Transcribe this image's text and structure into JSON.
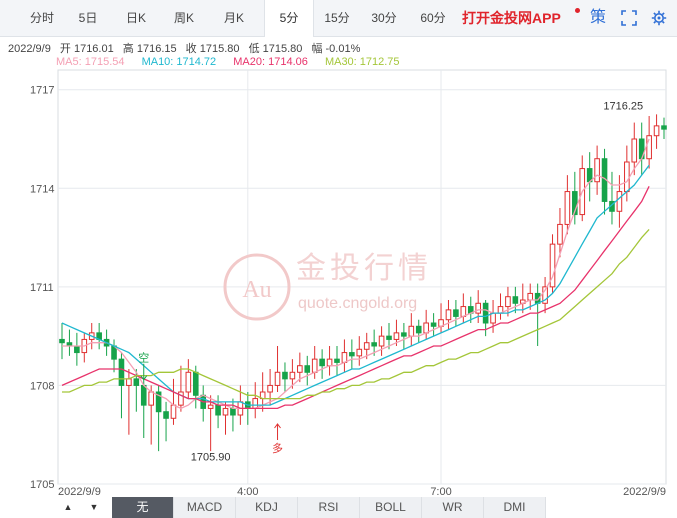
{
  "tabs": [
    "分时",
    "5日",
    "日K",
    "周K",
    "月K",
    "5分",
    "15分",
    "30分",
    "60分"
  ],
  "active_tab": 5,
  "promo": "打开金投网APP",
  "icons": {
    "strategy": "策",
    "fullscreen": "fullscreen-icon",
    "settings": "gear-icon"
  },
  "info": {
    "date": "2022/9/9",
    "open_label": "开",
    "open": "1716.01",
    "high_label": "高",
    "high": "1716.15",
    "close_label": "收",
    "close": "1715.80",
    "low_label": "低",
    "low": "1715.80",
    "change_label": "幅",
    "change": "-0.01%"
  },
  "ma_legend": [
    {
      "label": "MA5: 1715.54",
      "color": "#f4a0b4"
    },
    {
      "label": "MA10: 1714.72",
      "color": "#1fb8cf"
    },
    {
      "label": "MA20: 1714.06",
      "color": "#e8336b"
    },
    {
      "label": "MA30: 1712.75",
      "color": "#a4c639"
    }
  ],
  "watermark": {
    "cn": "金投行情",
    "en": "quote.cngold.org"
  },
  "bottom_tabs": [
    "无",
    "MACD",
    "KDJ",
    "RSI",
    "BOLL",
    "WR",
    "DMI"
  ],
  "bottom_active": 0,
  "chart_data": {
    "type": "candlestick",
    "y_ticks": [
      1717,
      1714,
      1711,
      1708,
      1705
    ],
    "ylim": [
      1705,
      1717.6
    ],
    "x_labels": [
      {
        "index": 0,
        "text": "2022/9/9"
      },
      {
        "index": 25,
        "text": "4:00"
      },
      {
        "index": 51,
        "text": "7:00"
      },
      {
        "index": 79,
        "text": "2022/9/9"
      }
    ],
    "colors": {
      "up": "#e03030",
      "down": "#16a34a"
    },
    "annotations": [
      {
        "text": "1716.25",
        "index": 79,
        "value": 1716.25
      },
      {
        "text": "1705.90",
        "index": 20,
        "value": 1705.9
      },
      {
        "text": "空",
        "index": 11,
        "value": 1708.6
      },
      {
        "text": "多",
        "index": 29,
        "value": 1706.4
      }
    ],
    "candles": [
      [
        1709.4,
        1709.3,
        1709.9,
        1708.8
      ],
      [
        1709.3,
        1709.2,
        1709.7,
        1708.9
      ],
      [
        1709.2,
        1709.0,
        1709.6,
        1708.6
      ],
      [
        1709.0,
        1709.4,
        1709.6,
        1708.7
      ],
      [
        1709.4,
        1709.6,
        1709.9,
        1709.1
      ],
      [
        1709.6,
        1709.4,
        1709.9,
        1709.1
      ],
      [
        1709.4,
        1709.2,
        1709.7,
        1708.9
      ],
      [
        1709.2,
        1708.8,
        1709.4,
        1708.4
      ],
      [
        1708.8,
        1708.0,
        1709.0,
        1707.0
      ],
      [
        1708.0,
        1708.2,
        1708.5,
        1706.5
      ],
      [
        1708.2,
        1708.0,
        1708.5,
        1707.2
      ],
      [
        1708.0,
        1707.4,
        1708.2,
        1706.4
      ],
      [
        1707.4,
        1707.8,
        1708.0,
        1706.2
      ],
      [
        1707.8,
        1707.2,
        1708.0,
        1706.0
      ],
      [
        1707.2,
        1707.0,
        1707.5,
        1706.3
      ],
      [
        1707.0,
        1707.4,
        1708.2,
        1706.8
      ],
      [
        1707.4,
        1707.8,
        1708.6,
        1707.2
      ],
      [
        1707.8,
        1708.4,
        1708.8,
        1707.6
      ],
      [
        1708.4,
        1707.7,
        1708.6,
        1707.3
      ],
      [
        1707.7,
        1707.3,
        1708.0,
        1706.9
      ],
      [
        1707.3,
        1707.4,
        1707.7,
        1706.0
      ],
      [
        1707.4,
        1707.1,
        1707.7,
        1706.7
      ],
      [
        1707.1,
        1707.3,
        1707.5,
        1706.5
      ],
      [
        1707.3,
        1707.1,
        1707.6,
        1706.6
      ],
      [
        1707.1,
        1707.5,
        1708.0,
        1706.8
      ],
      [
        1707.5,
        1707.3,
        1707.8,
        1706.8
      ],
      [
        1707.3,
        1707.6,
        1708.1,
        1707.0
      ],
      [
        1707.6,
        1707.8,
        1708.4,
        1707.2
      ],
      [
        1707.8,
        1708.0,
        1708.5,
        1707.4
      ],
      [
        1708.0,
        1708.4,
        1709.2,
        1707.8
      ],
      [
        1708.4,
        1708.2,
        1708.7,
        1707.8
      ],
      [
        1708.2,
        1708.4,
        1708.8,
        1707.9
      ],
      [
        1708.4,
        1708.6,
        1709.0,
        1708.1
      ],
      [
        1708.6,
        1708.4,
        1708.9,
        1708.0
      ],
      [
        1708.4,
        1708.8,
        1709.2,
        1708.2
      ],
      [
        1708.8,
        1708.6,
        1709.1,
        1708.2
      ],
      [
        1708.6,
        1708.8,
        1709.2,
        1708.3
      ],
      [
        1708.8,
        1708.7,
        1709.2,
        1708.3
      ],
      [
        1708.7,
        1709.0,
        1709.4,
        1708.4
      ],
      [
        1709.0,
        1708.9,
        1709.4,
        1708.5
      ],
      [
        1708.9,
        1709.1,
        1709.5,
        1708.6
      ],
      [
        1709.1,
        1709.3,
        1709.6,
        1708.8
      ],
      [
        1709.3,
        1709.2,
        1709.7,
        1708.9
      ],
      [
        1709.2,
        1709.5,
        1709.8,
        1708.9
      ],
      [
        1709.5,
        1709.4,
        1709.9,
        1709.1
      ],
      [
        1709.4,
        1709.6,
        1710.0,
        1709.2
      ],
      [
        1709.6,
        1709.5,
        1709.9,
        1709.1
      ],
      [
        1709.5,
        1709.8,
        1710.2,
        1709.2
      ],
      [
        1709.8,
        1709.6,
        1710.0,
        1709.3
      ],
      [
        1709.6,
        1709.9,
        1710.3,
        1709.4
      ],
      [
        1709.9,
        1709.8,
        1710.2,
        1709.5
      ],
      [
        1709.8,
        1710.0,
        1710.5,
        1709.6
      ],
      [
        1710.0,
        1710.3,
        1710.6,
        1709.7
      ],
      [
        1710.3,
        1710.1,
        1710.6,
        1709.8
      ],
      [
        1710.1,
        1710.4,
        1710.8,
        1709.9
      ],
      [
        1710.4,
        1710.2,
        1710.7,
        1709.9
      ],
      [
        1710.2,
        1710.5,
        1710.9,
        1709.9
      ],
      [
        1710.5,
        1709.9,
        1710.6,
        1709.5
      ],
      [
        1709.9,
        1710.2,
        1710.6,
        1709.6
      ],
      [
        1710.2,
        1710.4,
        1710.8,
        1710.0
      ],
      [
        1710.4,
        1710.7,
        1711.0,
        1710.1
      ],
      [
        1710.7,
        1710.5,
        1711.0,
        1710.2
      ],
      [
        1710.5,
        1710.6,
        1711.1,
        1710.2
      ],
      [
        1710.6,
        1710.8,
        1711.1,
        1710.3
      ],
      [
        1710.8,
        1710.5,
        1711.1,
        1709.2
      ],
      [
        1710.5,
        1711.0,
        1711.3,
        1710.2
      ],
      [
        1711.0,
        1712.3,
        1712.6,
        1710.8
      ],
      [
        1712.3,
        1712.9,
        1713.4,
        1711.9
      ],
      [
        1712.9,
        1713.9,
        1714.4,
        1712.6
      ],
      [
        1713.9,
        1713.2,
        1714.5,
        1712.9
      ],
      [
        1713.2,
        1714.6,
        1715.0,
        1713.0
      ],
      [
        1714.6,
        1714.2,
        1715.1,
        1713.6
      ],
      [
        1714.2,
        1714.9,
        1715.3,
        1713.8
      ],
      [
        1714.9,
        1713.6,
        1715.2,
        1713.2
      ],
      [
        1713.6,
        1713.3,
        1714.5,
        1712.9
      ],
      [
        1713.3,
        1713.9,
        1714.4,
        1712.8
      ],
      [
        1713.9,
        1714.8,
        1715.3,
        1713.6
      ],
      [
        1714.8,
        1715.5,
        1716.0,
        1714.4
      ],
      [
        1715.5,
        1714.9,
        1716.0,
        1714.4
      ],
      [
        1714.9,
        1715.6,
        1716.2,
        1714.6
      ],
      [
        1715.6,
        1715.9,
        1716.25,
        1715.2
      ],
      [
        1715.9,
        1715.8,
        1716.15,
        1715.5
      ]
    ],
    "series": [
      {
        "name": "MA5",
        "color": "#f4a0b4",
        "values": [
          1709.2,
          1709.2,
          1709.2,
          1709.2,
          1709.3,
          1709.3,
          1709.3,
          1709.2,
          1709.0,
          1708.7,
          1708.4,
          1708.0,
          1707.8,
          1707.7,
          1707.6,
          1707.4,
          1707.3,
          1707.4,
          1707.6,
          1707.7,
          1707.6,
          1707.5,
          1707.4,
          1707.3,
          1707.3,
          1707.3,
          1707.3,
          1707.4,
          1707.5,
          1707.6,
          1707.8,
          1708.0,
          1708.2,
          1708.3,
          1708.4,
          1708.5,
          1708.6,
          1708.6,
          1708.7,
          1708.8,
          1708.8,
          1708.9,
          1709.0,
          1709.1,
          1709.2,
          1709.3,
          1709.4,
          1709.5,
          1709.5,
          1709.6,
          1709.7,
          1709.8,
          1709.9,
          1710.0,
          1710.1,
          1710.2,
          1710.3,
          1710.3,
          1710.2,
          1710.2,
          1710.3,
          1710.4,
          1710.5,
          1710.6,
          1710.6,
          1710.9,
          1711.3,
          1712.0,
          1712.7,
          1713.3,
          1713.9,
          1714.2,
          1714.4,
          1714.3,
          1714.1,
          1714.1,
          1714.2,
          1714.6,
          1714.9,
          1715.5
        ]
      },
      {
        "name": "MA10",
        "color": "#1fb8cf",
        "values": [
          1709.9,
          1709.8,
          1709.7,
          1709.6,
          1709.5,
          1709.4,
          1709.3,
          1709.2,
          1709.1,
          1709.0,
          1708.8,
          1708.6,
          1708.4,
          1708.2,
          1708.0,
          1707.8,
          1707.7,
          1707.6,
          1707.6,
          1707.6,
          1707.5,
          1707.5,
          1707.5,
          1707.5,
          1707.5,
          1707.4,
          1707.4,
          1707.4,
          1707.4,
          1707.5,
          1707.6,
          1707.7,
          1707.8,
          1707.9,
          1708.0,
          1708.1,
          1708.2,
          1708.3,
          1708.4,
          1708.5,
          1708.5,
          1708.6,
          1708.7,
          1708.8,
          1708.9,
          1709.0,
          1709.1,
          1709.2,
          1709.3,
          1709.4,
          1709.5,
          1709.6,
          1709.7,
          1709.8,
          1709.9,
          1710.0,
          1710.1,
          1710.1,
          1710.2,
          1710.2,
          1710.2,
          1710.3,
          1710.3,
          1710.4,
          1710.5,
          1710.6,
          1710.8,
          1711.1,
          1711.5,
          1711.9,
          1712.3,
          1712.7,
          1713.1,
          1713.3,
          1713.5,
          1713.7,
          1713.9,
          1714.1,
          1714.4,
          1714.7
        ]
      },
      {
        "name": "MA20",
        "color": "#e8336b",
        "values": [
          1708.0,
          1708.1,
          1708.2,
          1708.3,
          1708.4,
          1708.5,
          1708.5,
          1708.5,
          1708.5,
          1708.4,
          1708.3,
          1708.2,
          1708.1,
          1708.0,
          1707.9,
          1707.8,
          1707.7,
          1707.6,
          1707.6,
          1707.5,
          1707.5,
          1707.4,
          1707.4,
          1707.4,
          1707.3,
          1707.3,
          1707.3,
          1707.3,
          1707.3,
          1707.3,
          1707.4,
          1707.4,
          1707.5,
          1707.6,
          1707.7,
          1707.8,
          1707.9,
          1708.0,
          1708.1,
          1708.2,
          1708.3,
          1708.4,
          1708.5,
          1708.6,
          1708.7,
          1708.8,
          1708.9,
          1708.9,
          1709.0,
          1709.1,
          1709.2,
          1709.2,
          1709.3,
          1709.4,
          1709.5,
          1709.6,
          1709.7,
          1709.7,
          1709.8,
          1709.9,
          1709.9,
          1710.0,
          1710.1,
          1710.2,
          1710.2,
          1710.3,
          1710.4,
          1710.5,
          1710.7,
          1710.9,
          1711.2,
          1711.5,
          1711.8,
          1712.1,
          1712.4,
          1712.7,
          1713.0,
          1713.3,
          1713.6,
          1714.06
        ]
      },
      {
        "name": "MA30",
        "color": "#a4c639",
        "values": [
          1707.8,
          1707.8,
          1707.9,
          1708.0,
          1708.0,
          1708.1,
          1708.1,
          1708.2,
          1708.2,
          1708.2,
          1708.3,
          1708.3,
          1708.3,
          1708.4,
          1708.4,
          1708.4,
          1708.5,
          1708.5,
          1708.4,
          1708.3,
          1708.2,
          1708.1,
          1708.0,
          1707.9,
          1707.8,
          1707.7,
          1707.7,
          1707.6,
          1707.6,
          1707.6,
          1707.6,
          1707.6,
          1707.6,
          1707.7,
          1707.7,
          1707.8,
          1707.8,
          1707.9,
          1707.9,
          1708.0,
          1708.0,
          1708.1,
          1708.1,
          1708.2,
          1708.2,
          1708.3,
          1708.4,
          1708.4,
          1708.5,
          1708.6,
          1708.6,
          1708.7,
          1708.8,
          1708.8,
          1708.9,
          1709.0,
          1709.0,
          1709.1,
          1709.2,
          1709.3,
          1709.3,
          1709.4,
          1709.5,
          1709.6,
          1709.7,
          1709.8,
          1709.9,
          1710.0,
          1710.2,
          1710.4,
          1710.6,
          1710.8,
          1711.0,
          1711.2,
          1711.4,
          1711.7,
          1711.9,
          1712.2,
          1712.5,
          1712.75
        ]
      }
    ]
  }
}
